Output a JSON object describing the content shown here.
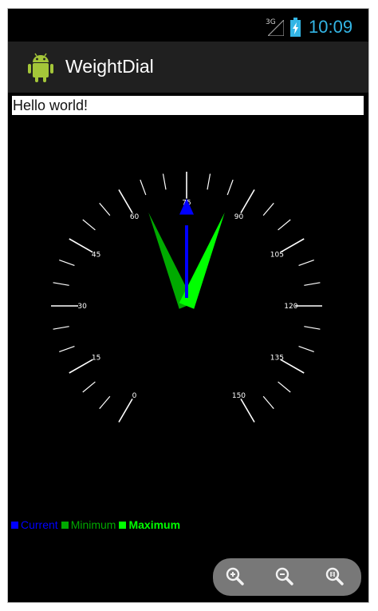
{
  "status_bar": {
    "network_label": "3G",
    "time": "10:09",
    "time_color": "#33b5e5"
  },
  "action_bar": {
    "app_title": "WeightDial",
    "icon": "android-robot-icon"
  },
  "content": {
    "hello_text": "Hello world!"
  },
  "dial": {
    "tick_labels": [
      "0",
      "15",
      "30",
      "45",
      "60",
      "75",
      "90",
      "105",
      "120",
      "135",
      "150"
    ],
    "min_value": 0,
    "max_value": 150,
    "current_value": 75,
    "minimum_value": 64,
    "maximum_value": 86,
    "colors": {
      "current": "#0000ff",
      "minimum": "#00aa00",
      "maximum": "#00ff00"
    }
  },
  "legend": {
    "items": [
      {
        "label": "Current",
        "color": "#0000ff"
      },
      {
        "label": "Minimum",
        "color": "#00aa00"
      },
      {
        "label": "Maximum",
        "color": "#00ff00"
      }
    ]
  },
  "zoom_controls": {
    "buttons": [
      "zoom-in-icon",
      "zoom-out-icon",
      "zoom-fit-icon"
    ]
  }
}
